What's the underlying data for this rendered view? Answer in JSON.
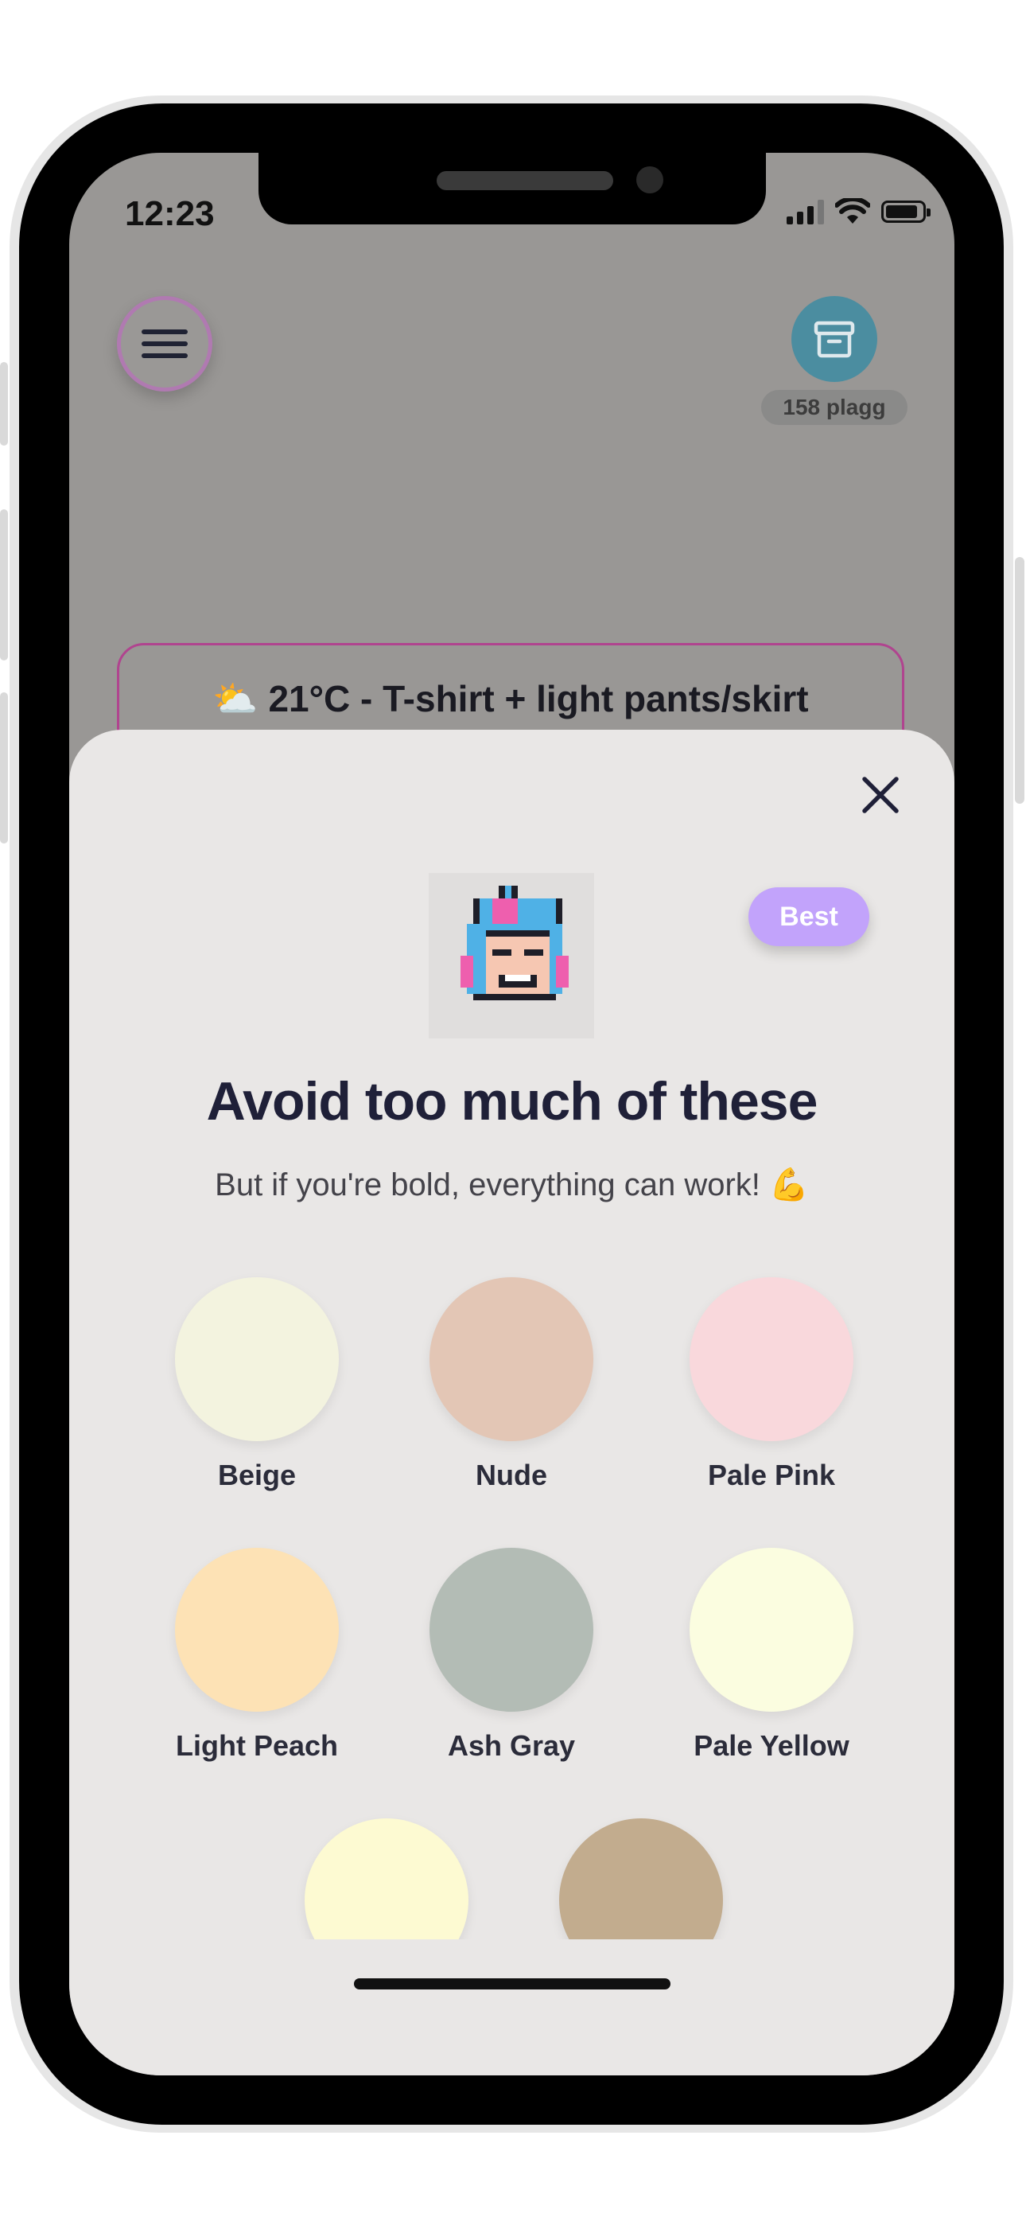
{
  "status_bar": {
    "time": "12:23"
  },
  "header": {
    "items_count": "158 plagg"
  },
  "weather": {
    "emoji": "⛅",
    "text": "21°C - T-shirt + light pants/skirt"
  },
  "sheet": {
    "badge": "Best",
    "title": "Avoid too much of these",
    "subtitle": "But if you're bold, everything can work! 💪",
    "colors": [
      {
        "name": "Beige",
        "hex": "#f3f3df"
      },
      {
        "name": "Nude",
        "hex": "#e3c6b5"
      },
      {
        "name": "Pale Pink",
        "hex": "#f9d8dc"
      },
      {
        "name": "Light Peach",
        "hex": "#fde2b5"
      },
      {
        "name": "Ash Gray",
        "hex": "#b3bcb5"
      },
      {
        "name": "Pale Yellow",
        "hex": "#fbfde0"
      },
      {
        "name": "",
        "hex": "#fdfad2"
      },
      {
        "name": "",
        "hex": "#c2ac8e"
      }
    ]
  },
  "colors": {
    "backdrop": "#999795",
    "sheet": "#e9e7e6",
    "accent_magenta": "#b0448f",
    "archive_teal": "#4b8da0",
    "badge_purple": "#c2a3fb",
    "title_navy": "#1f2038"
  }
}
